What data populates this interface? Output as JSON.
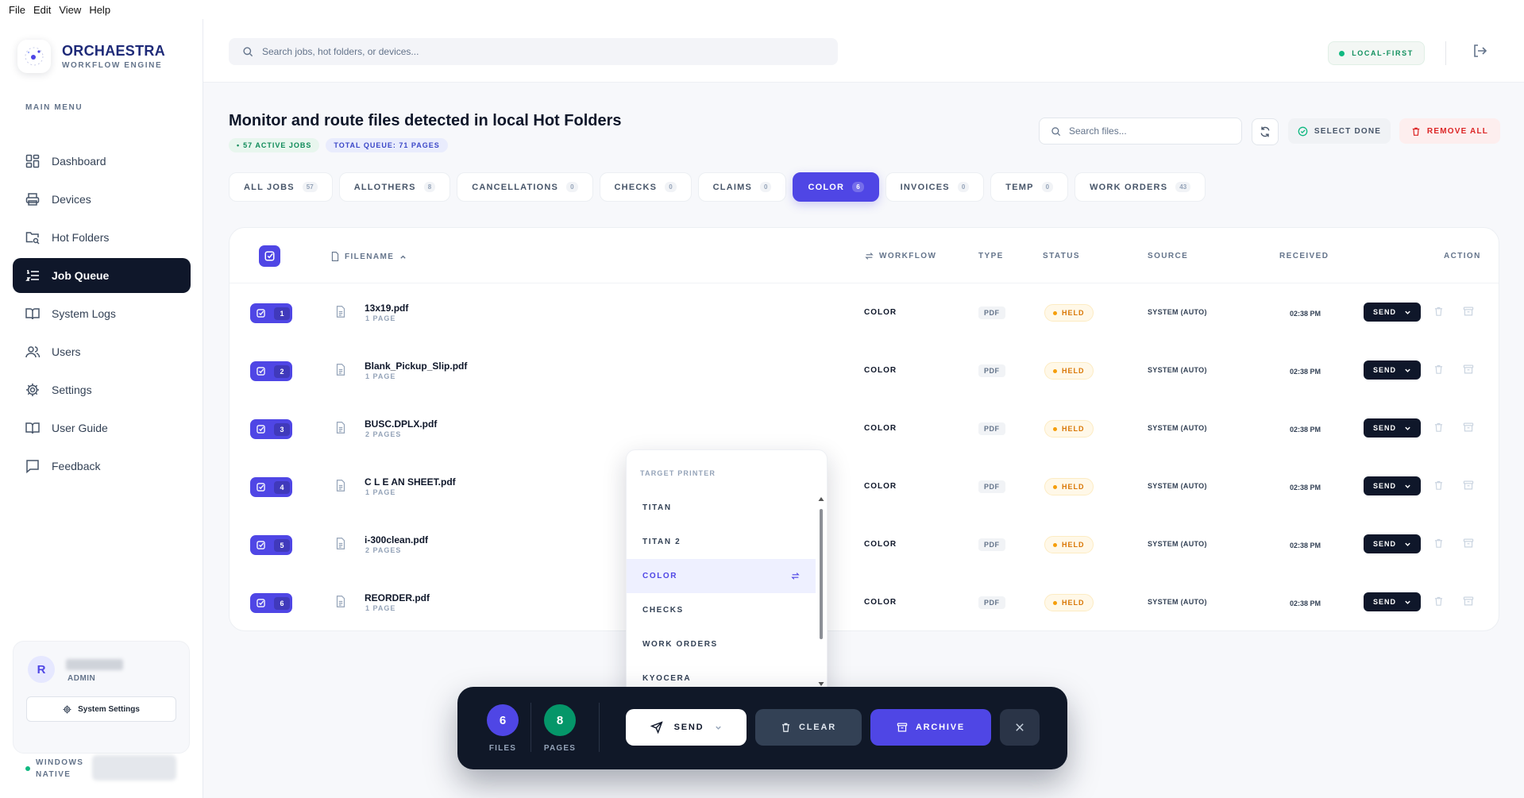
{
  "menubar": [
    "File",
    "Edit",
    "View",
    "Help"
  ],
  "brand": {
    "name": "ORCHAESTRA",
    "subtitle": "WORKFLOW ENGINE"
  },
  "sidebar": {
    "menu_heading": "MAIN MENU",
    "items": [
      {
        "label": "Dashboard",
        "icon": "dashboard-icon",
        "active": false
      },
      {
        "label": "Devices",
        "icon": "printer-icon",
        "active": false
      },
      {
        "label": "Hot Folders",
        "icon": "folder-search-icon",
        "active": false
      },
      {
        "label": "Job Queue",
        "icon": "list-ordered-icon",
        "active": true
      },
      {
        "label": "System Logs",
        "icon": "book-open-icon",
        "active": false
      },
      {
        "label": "Users",
        "icon": "users-icon",
        "active": false
      },
      {
        "label": "Settings",
        "icon": "gear-icon",
        "active": false
      },
      {
        "label": "User Guide",
        "icon": "book-icon",
        "active": false
      },
      {
        "label": "Feedback",
        "icon": "message-square-icon",
        "active": false
      }
    ],
    "user": {
      "initial": "R",
      "role": "ADMIN",
      "settings_label": "System Settings"
    },
    "environment": {
      "line1": "WINDOWS",
      "line2": "NATIVE"
    }
  },
  "topbar": {
    "search_placeholder": "Search jobs, hot folders, or devices...",
    "status_label": "LOCAL-FIRST"
  },
  "header": {
    "title": "Monitor and route files detected in local Hot Folders",
    "active_jobs": "57 ACTIVE JOBS",
    "total_queue": "TOTAL QUEUE: 71 PAGES",
    "search_placeholder": "Search files...",
    "select_done_label": "SELECT DONE",
    "remove_all_label": "REMOVE ALL"
  },
  "tabs": [
    {
      "label": "ALL JOBS",
      "count": "57",
      "active": false
    },
    {
      "label": "ALLOTHERS",
      "count": "8",
      "active": false
    },
    {
      "label": "CANCELLATIONS",
      "count": "0",
      "active": false
    },
    {
      "label": "CHECKS",
      "count": "0",
      "active": false
    },
    {
      "label": "CLAIMS",
      "count": "0",
      "active": false
    },
    {
      "label": "COLOR",
      "count": "6",
      "active": true
    },
    {
      "label": "INVOICES",
      "count": "0",
      "active": false
    },
    {
      "label": "TEMP",
      "count": "0",
      "active": false
    },
    {
      "label": "WORK ORDERS",
      "count": "43",
      "active": false
    }
  ],
  "table": {
    "columns": {
      "filename": "FILENAME",
      "workflow": "WORKFLOW",
      "type": "TYPE",
      "status": "STATUS",
      "source": "SOURCE",
      "received": "RECEIVED",
      "action": "ACTION"
    },
    "rows": [
      {
        "num": "1",
        "filename": "13x19.pdf",
        "pages": "1 PAGE",
        "workflow": "COLOR",
        "type": "PDF",
        "status": "HELD",
        "source": "SYSTEM (AUTO)",
        "received": "02:38 PM",
        "action": "SEND"
      },
      {
        "num": "2",
        "filename": "Blank_Pickup_Slip.pdf",
        "pages": "1 PAGE",
        "workflow": "COLOR",
        "type": "PDF",
        "status": "HELD",
        "source": "SYSTEM (AUTO)",
        "received": "02:38 PM",
        "action": "SEND"
      },
      {
        "num": "3",
        "filename": "BUSC.DPLX.pdf",
        "pages": "2 PAGES",
        "workflow": "COLOR",
        "type": "PDF",
        "status": "HELD",
        "source": "SYSTEM (AUTO)",
        "received": "02:38 PM",
        "action": "SEND"
      },
      {
        "num": "4",
        "filename": "C L E AN SHEET.pdf",
        "pages": "1 PAGE",
        "workflow": "COLOR",
        "type": "PDF",
        "status": "HELD",
        "source": "SYSTEM (AUTO)",
        "received": "02:38 PM",
        "action": "SEND"
      },
      {
        "num": "5",
        "filename": "i-300clean.pdf",
        "pages": "2 PAGES",
        "workflow": "COLOR",
        "type": "PDF",
        "status": "HELD",
        "source": "SYSTEM (AUTO)",
        "received": "02:38 PM",
        "action": "SEND"
      },
      {
        "num": "6",
        "filename": "REORDER.pdf",
        "pages": "1 PAGE",
        "workflow": "COLOR",
        "type": "PDF",
        "status": "HELD",
        "source": "SYSTEM (AUTO)",
        "received": "02:38 PM",
        "action": "SEND"
      }
    ]
  },
  "dropdown": {
    "heading": "TARGET PRINTER",
    "items": [
      {
        "label": "TITAN",
        "selected": false
      },
      {
        "label": "TITAN 2",
        "selected": false
      },
      {
        "label": "COLOR",
        "selected": true
      },
      {
        "label": "CHECKS",
        "selected": false
      },
      {
        "label": "WORK ORDERS",
        "selected": false
      },
      {
        "label": "KYOCERA",
        "selected": false
      }
    ]
  },
  "actionbar": {
    "files_count": "6",
    "files_label": "FILES",
    "pages_count": "8",
    "pages_label": "PAGES",
    "send_label": "SEND",
    "clear_label": "CLEAR",
    "archive_label": "ARCHIVE"
  },
  "colors": {
    "accent": "#4f46e5",
    "dark": "#0f172a",
    "held": "#d97706",
    "success": "#10b981",
    "danger": "#dc2626"
  }
}
